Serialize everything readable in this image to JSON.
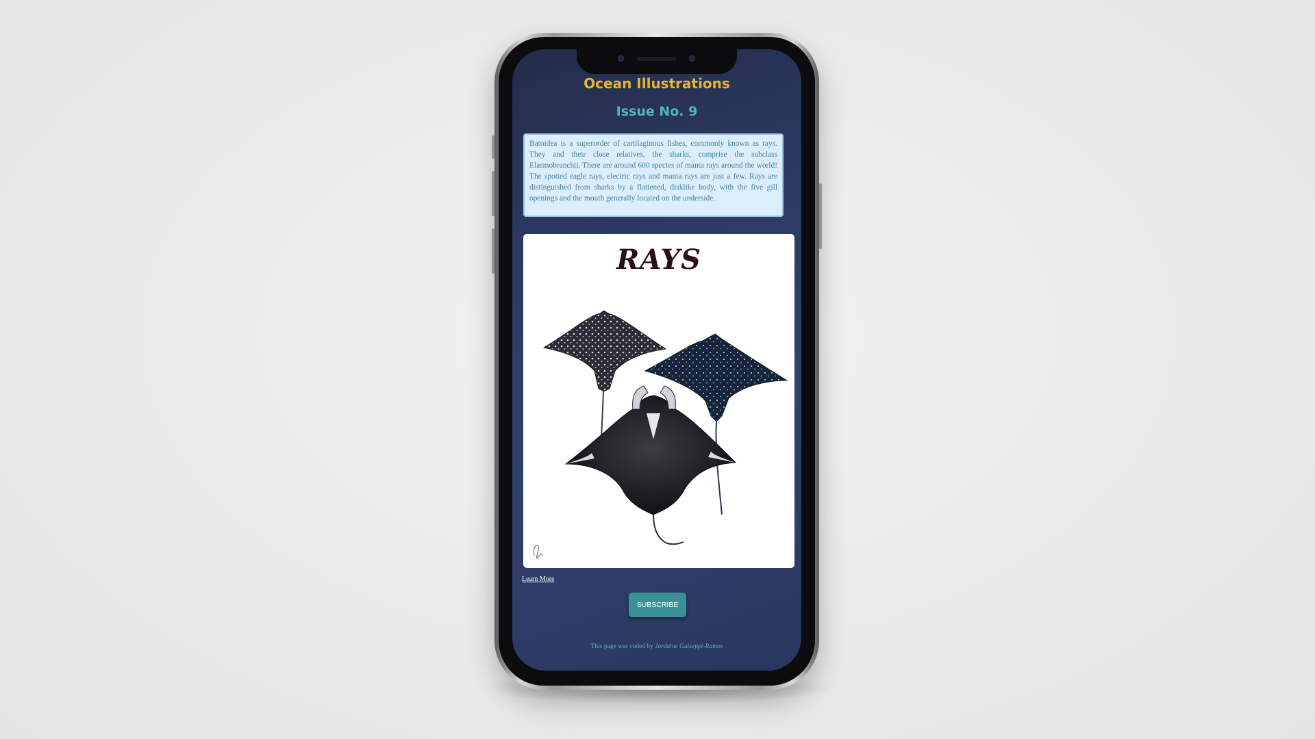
{
  "page": {
    "title": "Ocean Illustrations",
    "issue": "Issue No. 9",
    "description": "Batoidea is a superorder of cartilaginous fishes, commonly known as rays. They and their close relatives, the sharks, comprise the subclass Elasmobranchii. There are around 600 species of manta rays around the world! The spotted eagle rays, electric rays and manta rays are just a few. Rays are distinguished from sharks by a flattened, disklike body, with the five gill openings and the mouth generally located on the underside.",
    "illustration": {
      "title": "RAYS",
      "subjects": [
        "spotted-eagle-ray",
        "white-spotted-eagle-ray",
        "manta-ray"
      ],
      "signature": "artist signature"
    },
    "learn_more_label": "Learn More",
    "subscribe_label": "SUBSCRIBE",
    "footer_prefix": "This page was coded by ",
    "footer_author": "Jordaine Guiseppi-Ramos"
  },
  "colors": {
    "title": "#e9b531",
    "issue": "#4fb7c2",
    "screen_background": "#2c3a63",
    "description_background": "#dceefb",
    "description_text": "#3e7fa3",
    "subscribe_button": "#3b8f96"
  },
  "device": {
    "type": "smartphone",
    "icons": [
      "front-camera-icon",
      "speaker-grille-icon"
    ]
  }
}
